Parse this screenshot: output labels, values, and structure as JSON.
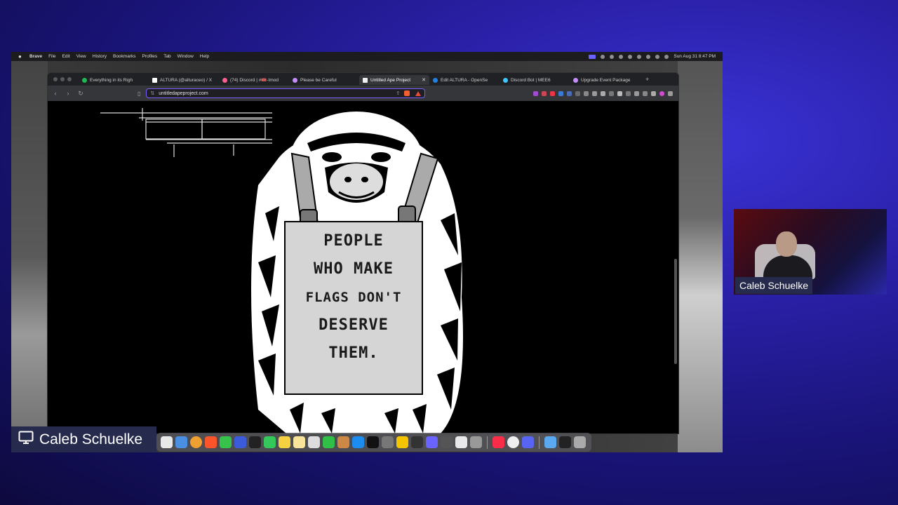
{
  "menubar": {
    "app_name": "Brave",
    "items": [
      "File",
      "Edit",
      "View",
      "History",
      "Bookmarks",
      "Profiles",
      "Tab",
      "Window",
      "Help"
    ],
    "clock": "Sun Aug 31  8:47 PM"
  },
  "tabs": [
    {
      "label": "Everything in its Righ",
      "color": "#1db954"
    },
    {
      "label": "ALTURA (@alturaceo) / X",
      "color": "#ffffff"
    },
    {
      "label": "(74) Discord | #🎟️-tmod",
      "color": "#ff5f8f"
    },
    {
      "label": "Please be Careful",
      "color": "#c48cff"
    },
    {
      "label": "Untitled Ape Project",
      "color": "#f0f0f0",
      "active": true
    },
    {
      "label": "Edit ALTURA - OpenSe",
      "color": "#2081e2"
    },
    {
      "label": "Discord Bot | MEE6",
      "color": "#3ec6ff"
    },
    {
      "label": "Upgrade Event Package",
      "color": "#c48cff"
    }
  ],
  "toolbar": {
    "url": "untitledapeproject.com"
  },
  "sign_lines": [
    "PEOPLE",
    "WHO MAKE",
    "FLAGS DON'T",
    "DESERVE",
    "THEM."
  ],
  "presenter_name": "Caleb Schuelke",
  "webcam_name": "Caleb Schuelke",
  "colors": {
    "accent": "#7a5cff",
    "presenter_bg": "#262b4e"
  }
}
